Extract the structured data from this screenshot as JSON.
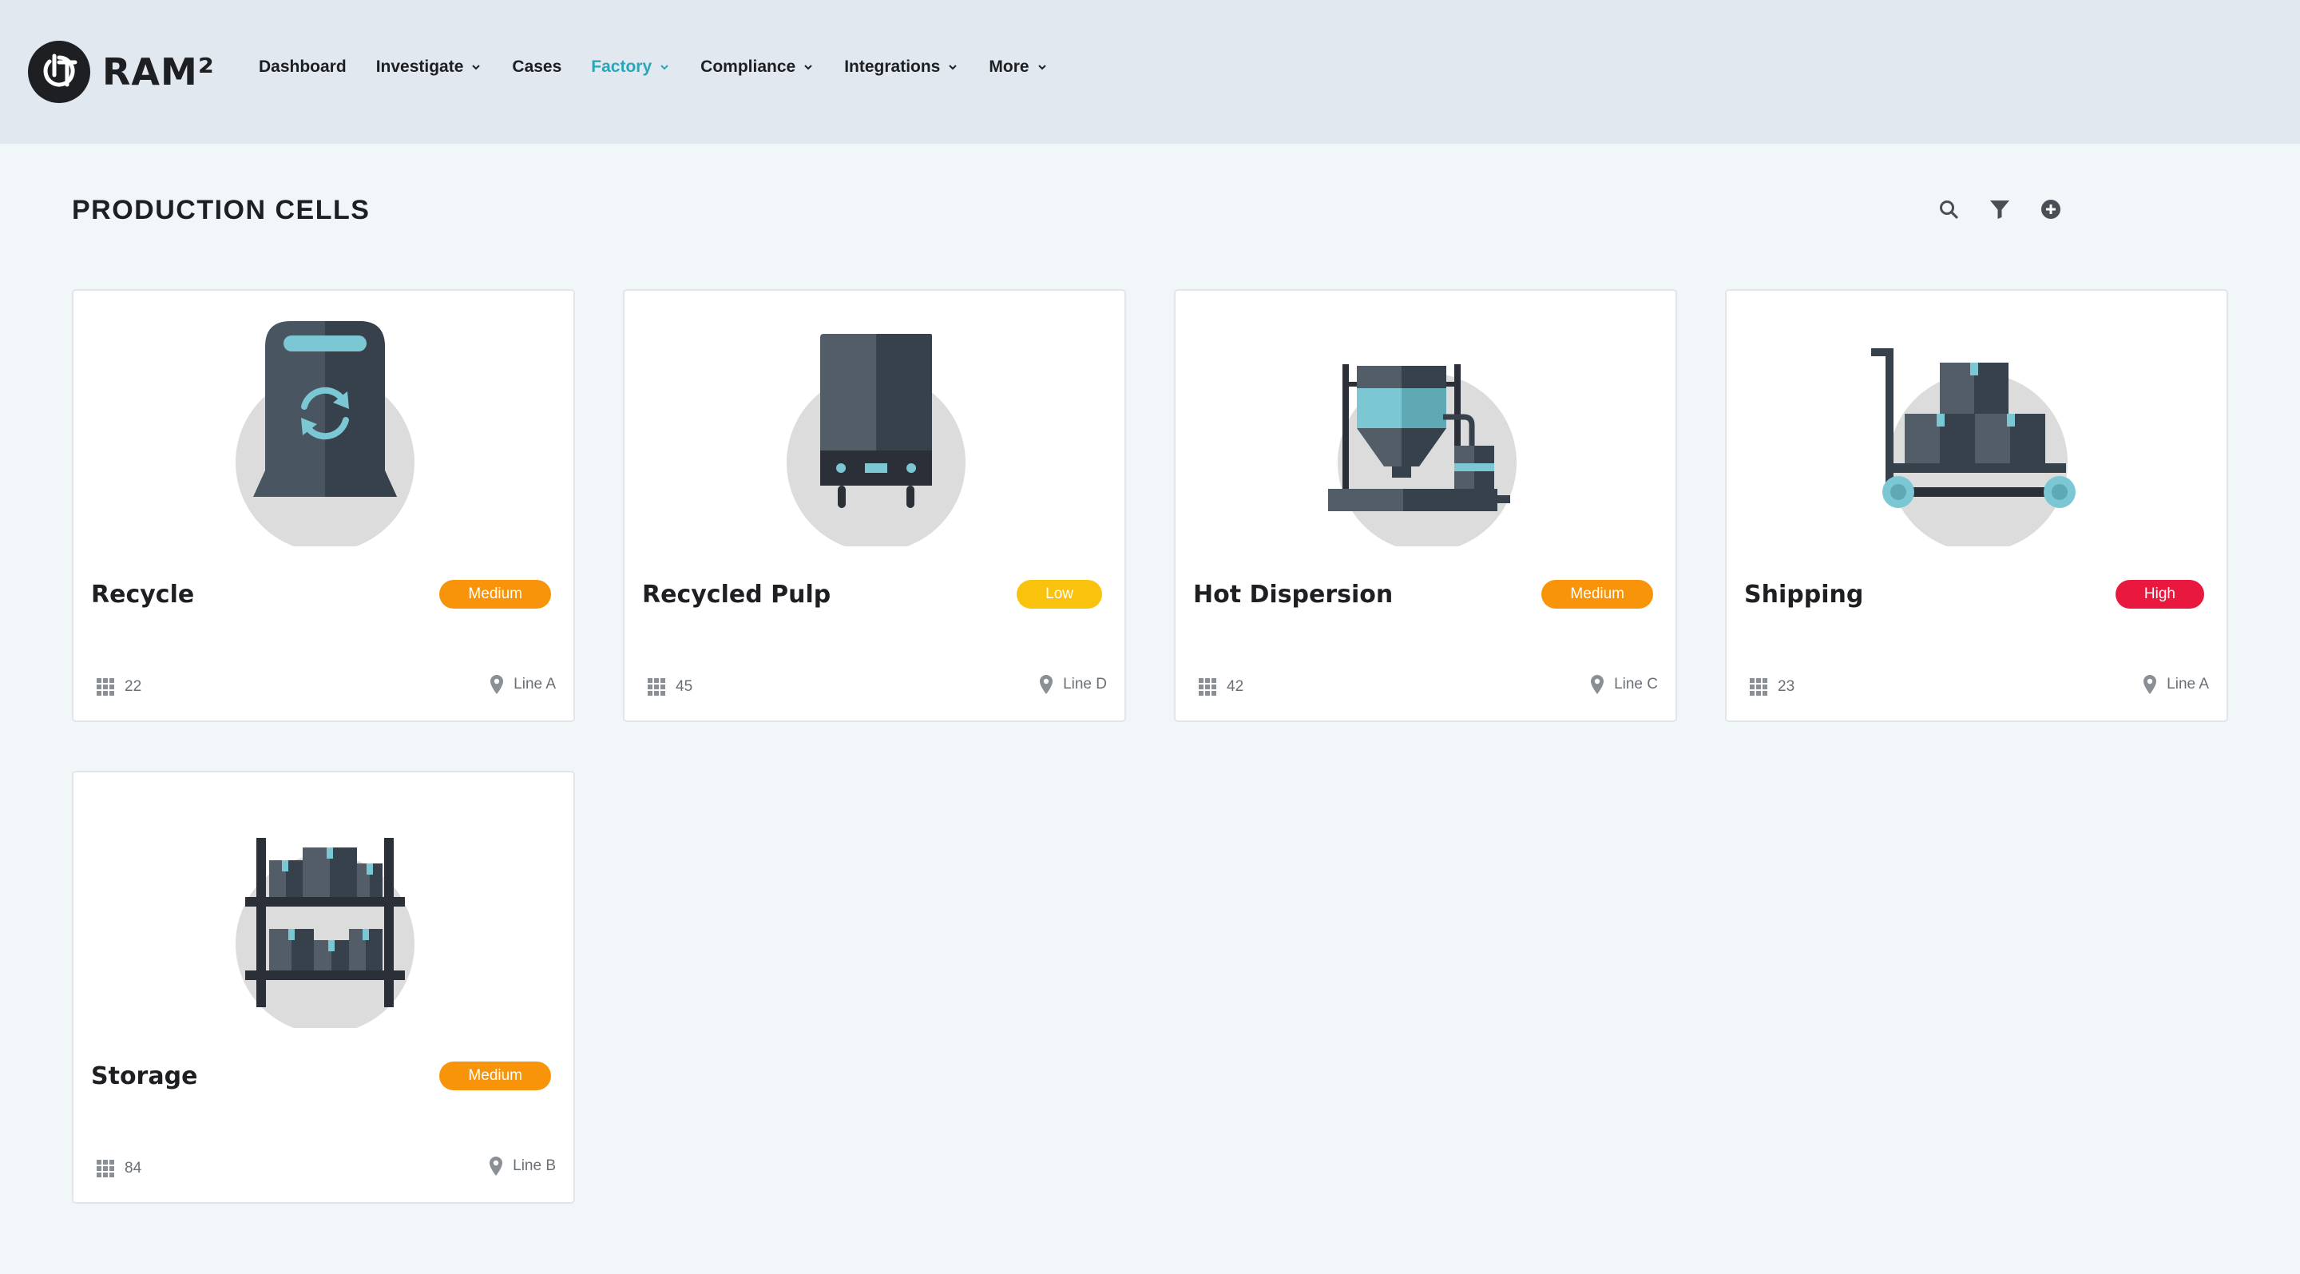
{
  "app": {
    "logo_text": "RAM²"
  },
  "nav": {
    "items": [
      {
        "label": "Dashboard",
        "dropdown": false,
        "active": false
      },
      {
        "label": "Investigate",
        "dropdown": true,
        "active": false
      },
      {
        "label": "Cases",
        "dropdown": false,
        "active": false
      },
      {
        "label": "Factory",
        "dropdown": true,
        "active": true
      },
      {
        "label": "Compliance",
        "dropdown": true,
        "active": false
      },
      {
        "label": "Integrations",
        "dropdown": true,
        "active": false
      },
      {
        "label": "More",
        "dropdown": true,
        "active": false
      }
    ]
  },
  "page": {
    "title": "PRODUCTION CELLS",
    "tools": [
      "search-icon",
      "filter-icon",
      "add-circle-icon"
    ]
  },
  "cells": [
    {
      "name": "Recycle",
      "risk": "Medium",
      "risk_level": "medium",
      "count": "22",
      "location": "Line A",
      "icon": "recycle-bin-icon"
    },
    {
      "name": "Recycled Pulp",
      "risk": "Low",
      "risk_level": "low",
      "count": "45",
      "location": "Line D",
      "icon": "pulp-tank-icon"
    },
    {
      "name": "Hot Dispersion",
      "risk": "Medium",
      "risk_level": "medium",
      "count": "42",
      "location": "Line C",
      "icon": "silo-machine-icon"
    },
    {
      "name": "Shipping",
      "risk": "High",
      "risk_level": "high",
      "count": "23",
      "location": "Line A",
      "icon": "hand-truck-icon"
    },
    {
      "name": "Storage",
      "risk": "Medium",
      "risk_level": "medium",
      "count": "84",
      "location": "Line B",
      "icon": "storage-shelf-icon"
    }
  ],
  "colors": {
    "accent": "#2aa6b9",
    "header_bg": "#e1e8ef",
    "page_bg": "#f1f6f9",
    "risk_medium": "#f7940a",
    "risk_low": "#f8c20d",
    "risk_high": "#e8183e"
  }
}
